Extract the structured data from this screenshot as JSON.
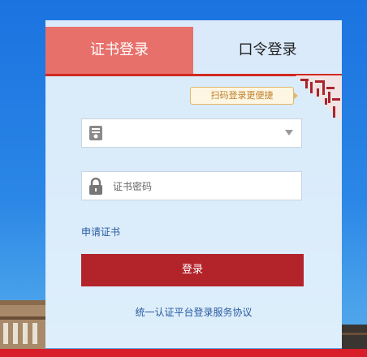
{
  "tabs": {
    "cert_login": "证书登录",
    "password_login": "口令登录"
  },
  "qr_tip": "扫码登录更便捷",
  "cert_select": {
    "selected": ""
  },
  "password": {
    "placeholder": "证书密码",
    "value": ""
  },
  "apply_cert_link": "申请证书",
  "login_button": "登录",
  "agreement_link": "统一认证平台登录服务协议",
  "colors": {
    "accent_red": "#b3232a",
    "active_tab": "#e8706b",
    "link_blue": "#2a5aa0",
    "background_blue": "#1b73e0"
  },
  "icons": {
    "cert": "certificate-icon",
    "lock": "lock-icon",
    "dropdown": "chevron-down-icon",
    "qr_corner": "qr-code-icon"
  }
}
